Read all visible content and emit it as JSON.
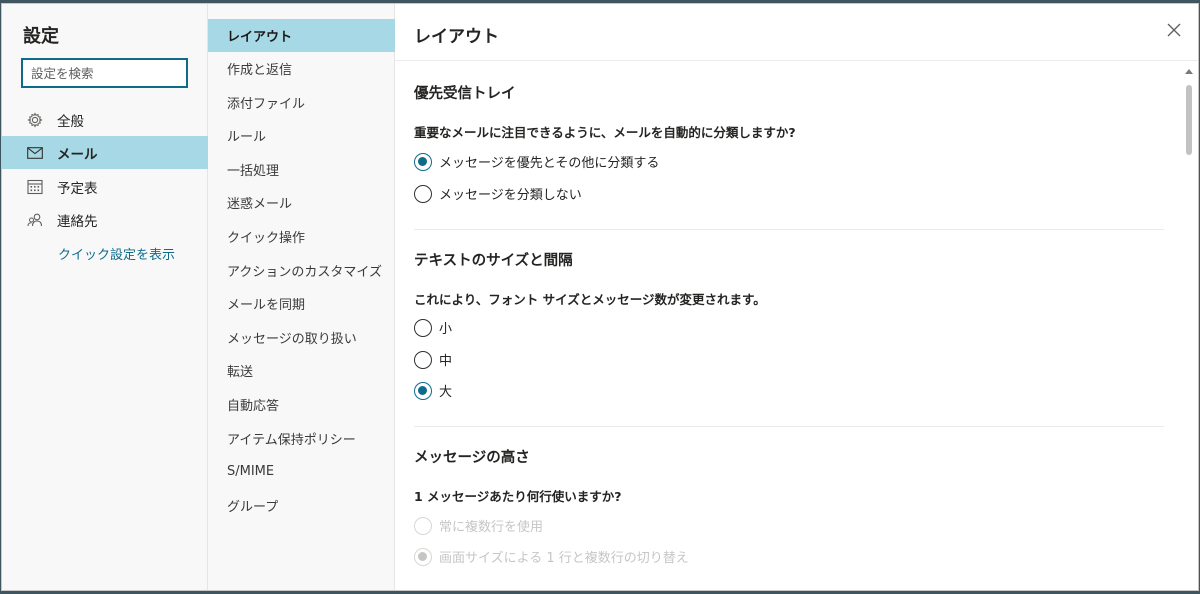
{
  "settings": {
    "title": "設定",
    "search_placeholder": "設定を検索",
    "categories": [
      {
        "label": "全般",
        "icon": "gear-icon"
      },
      {
        "label": "メール",
        "icon": "mail-icon"
      },
      {
        "label": "予定表",
        "icon": "calendar-icon"
      },
      {
        "label": "連絡先",
        "icon": "people-icon"
      }
    ],
    "quick_settings_link": "クイック設定を表示"
  },
  "subnav": {
    "items": [
      "レイアウト",
      "作成と返信",
      "添付ファイル",
      "ルール",
      "一括処理",
      "迷惑メール",
      "クイック操作",
      "アクションのカスタマイズ",
      "メールを同期",
      "メッセージの取り扱い",
      "転送",
      "自動応答",
      "アイテム保持ポリシー",
      "S/MIME",
      "グループ"
    ]
  },
  "pane": {
    "title": "レイアウト",
    "focused_inbox": {
      "heading": "優先受信トレイ",
      "question": "重要なメールに注目できるように、メールを自動的に分類しますか?",
      "option1": "メッセージを優先とその他に分類する",
      "option2": "メッセージを分類しない"
    },
    "text_size": {
      "heading": "テキストのサイズと間隔",
      "question": "これにより、フォント サイズとメッセージ数が変更されます。",
      "small": "小",
      "medium": "中",
      "large": "大"
    },
    "message_height": {
      "heading": "メッセージの高さ",
      "question": "1 メッセージあたり何行使いますか?",
      "option1": "常に複数行を使用",
      "option2": "画面サイズによる 1 行と複数行の切り替え"
    }
  },
  "colors": {
    "accent": "#0f6b8c",
    "selected_bg": "#a6d8e5"
  }
}
